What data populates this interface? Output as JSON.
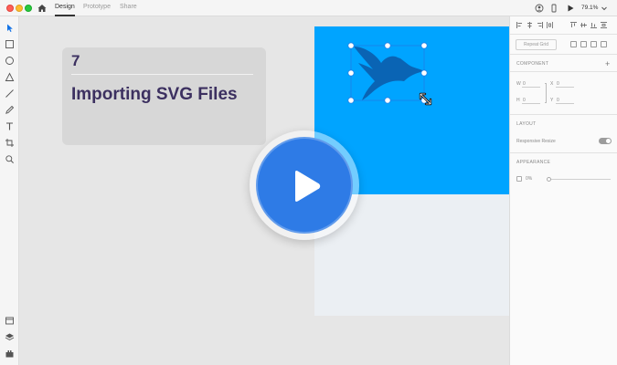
{
  "tabs": [
    {
      "label": "Design",
      "active": true
    },
    {
      "label": "Prototype",
      "active": false
    },
    {
      "label": "Share",
      "active": false
    }
  ],
  "zoom": "79.1%",
  "lesson": {
    "number": "7",
    "title": "Importing SVG Files"
  },
  "panel": {
    "repeat_grid_label": "Repeat Grid",
    "component_label": "COMPONENT",
    "w_label": "W",
    "w_value": "0",
    "h_label": "H",
    "h_value": "0",
    "x_label": "X",
    "x_value": "0",
    "y_label": "Y",
    "y_value": "0",
    "layout_label": "LAYOUT",
    "responsive_resize_label": "Responsive Resize",
    "responsive_resize_on": true,
    "appearance_label": "APPEARANCE",
    "opacity_value": "0%"
  },
  "icons": {
    "titlebar": [
      "home-icon",
      "user-icon",
      "mobile-preview-icon",
      "play-preview-icon",
      "chevron-down-icon"
    ],
    "tools": [
      "select-icon",
      "rectangle-icon",
      "ellipse-icon",
      "polygon-icon",
      "line-icon",
      "pen-icon",
      "text-icon",
      "artboard-icon",
      "zoom-icon",
      "assets-icon",
      "layers-icon",
      "plugins-icon"
    ]
  },
  "colors": {
    "artboard_blue": "#00a4ff",
    "artboard_light": "#ebeff3",
    "logo_blue": "#0a64b4",
    "play_button": "#2e7be6",
    "title_text": "#3c3060"
  }
}
